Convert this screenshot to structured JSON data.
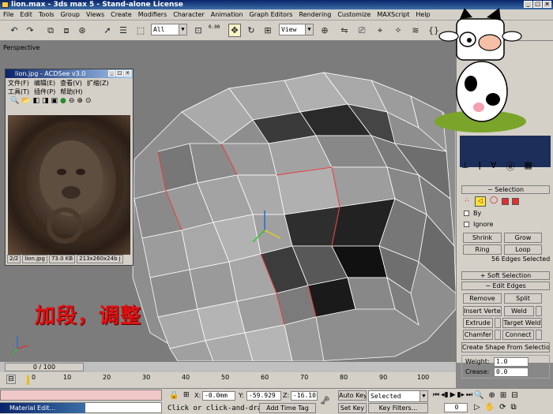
{
  "window": {
    "title": "lion.max - 3ds max 5 - Stand-alone License"
  },
  "menu": [
    "File",
    "Edit",
    "Tools",
    "Group",
    "Views",
    "Create",
    "Modifiers",
    "Character",
    "Animation",
    "Graph Editors",
    "Rendering",
    "Customize",
    "MAXScript",
    "Help"
  ],
  "toolbar": {
    "selection_filter": "All",
    "view_combo": "View",
    "spinner_value": "0.00"
  },
  "viewport": {
    "label": "Perspective",
    "overlay_text": "加段，调整"
  },
  "acdsee": {
    "title": "lion.jpg - ACDSee v3.0",
    "menu_row1": [
      "文件(F)",
      "编辑(E)",
      "查看(V)",
      "扩缩(Z)"
    ],
    "menu_row2": [
      "工具(T)",
      "插件(P)",
      "帮助(H)"
    ],
    "status": [
      "2/2",
      "lion.jpg",
      "73.0 KB",
      "213x260x24b j"
    ]
  },
  "command_panel": {
    "selection": {
      "header": "Selection",
      "by_label": "By",
      "ignore_label": "Ignore",
      "shrink": "Shrink",
      "grow": "Grow",
      "ring": "Ring",
      "loop": "Loop",
      "selected_info": "56 Edges Selected"
    },
    "soft_selection": {
      "header": "Soft Selection"
    },
    "edit_edges": {
      "header": "Edit Edges",
      "remove": "Remove",
      "split": "Split",
      "insert_vertex": "Insert Vertex",
      "weld": "Weld",
      "extrude": "Extrude",
      "target_weld": "Target Weld",
      "chamfer": "Chamfer",
      "connect": "Connect",
      "create_shape": "Create Shape From Selection",
      "weight_label": "Weight:",
      "weight_value": "1.0",
      "crease_label": "Crease:",
      "crease_value": "0.0"
    }
  },
  "timeline": {
    "slider": "0 / 100",
    "ticks": [
      "0",
      "10",
      "20",
      "30",
      "40",
      "50",
      "60",
      "70",
      "80",
      "90",
      "100"
    ]
  },
  "status": {
    "mini_listener_label": "Material Edit...",
    "x_label": "X:",
    "x_value": "-0.0mm",
    "y_label": "Y:",
    "y_value": "-59.929",
    "z_label": "Z:",
    "z_value": "-16.10",
    "auto_key": "Auto Key",
    "key_mode": "Selected",
    "set_key": "Set Key",
    "key_filters": "Key Filters...",
    "prompt": "Click or click-and-drag",
    "add_time_tag": "Add Time Tag",
    "frame": "0"
  },
  "colors": {
    "titlebar": "#0a246a",
    "viewport_bg": "#7c7c7c",
    "panel_bg": "#d4d0c8",
    "selected_edges": "#e03030",
    "overlay_red": "#e01010"
  }
}
